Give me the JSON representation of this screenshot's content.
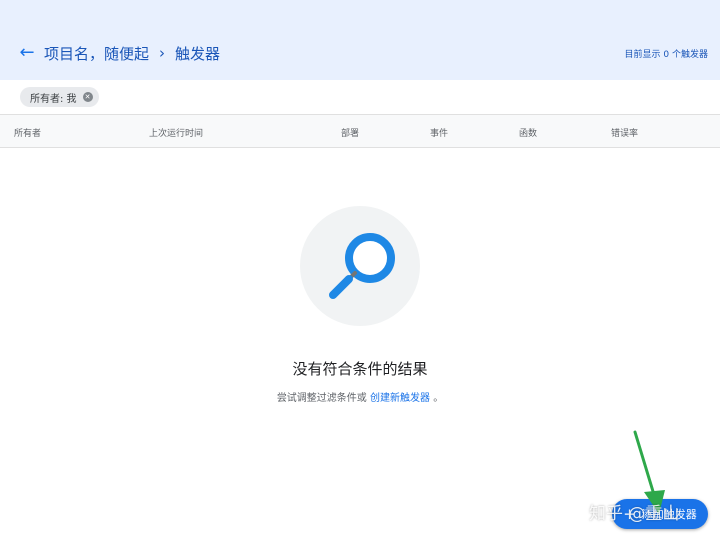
{
  "header": {
    "breadcrumb": {
      "project": "项目名，随便起",
      "separator": "›",
      "page": "触发器"
    },
    "status_text": "目前显示 0 个触发器"
  },
  "filters": {
    "chip_label": "所有者: 我"
  },
  "table": {
    "columns": [
      "所有者",
      "上次运行时间",
      "部署",
      "事件",
      "函数",
      "错误率"
    ]
  },
  "empty_state": {
    "title": "没有符合条件的结果",
    "subtitle_prefix": "尝试调整过滤条件或",
    "subtitle_link": "创建新触发器",
    "subtitle_suffix": "。"
  },
  "fab": {
    "label": "添加触发器"
  },
  "watermark": "知乎 @重山",
  "colors": {
    "header_bg": "#e8f0fe",
    "accent": "#1a73e8",
    "annotation_arrow": "#2ea84a"
  },
  "icons": {
    "back": "arrow-left-icon",
    "chip_close": "close-circle-icon",
    "empty": "magnifier-icon",
    "fab": "plus-icon"
  }
}
